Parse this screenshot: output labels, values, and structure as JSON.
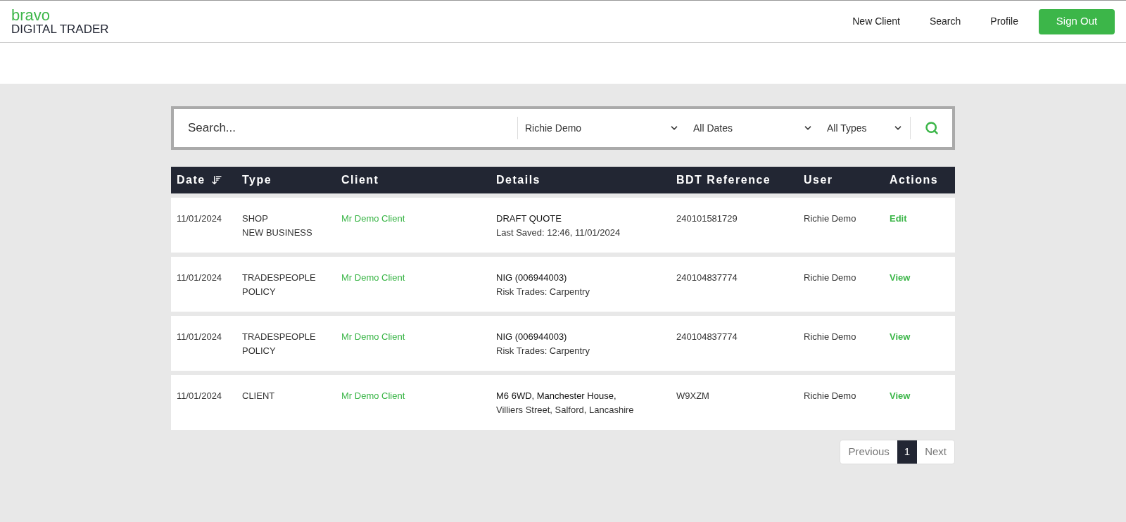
{
  "brand": {
    "logo_top": "bravo",
    "logo_bottom": "DIGITAL TRADER"
  },
  "nav": {
    "links": [
      "New Client",
      "Search",
      "Profile"
    ],
    "sign_out": "Sign Out"
  },
  "search": {
    "placeholder": "Search...",
    "filters": [
      "Richie Demo",
      "All Dates",
      "All Types"
    ]
  },
  "table": {
    "columns": [
      {
        "label": "Date",
        "sortable": true
      },
      {
        "label": "Type",
        "sortable": false
      },
      {
        "label": "Client",
        "sortable": false
      },
      {
        "label": "Details",
        "sortable": false
      },
      {
        "label": "BDT Reference",
        "sortable": false
      },
      {
        "label": "User",
        "sortable": false
      },
      {
        "label": "Actions",
        "sortable": false
      }
    ],
    "rows": [
      {
        "date": "11/01/2024",
        "type": [
          "SHOP",
          "NEW BUSINESS"
        ],
        "client": "Mr Demo Client",
        "details": [
          "DRAFT QUOTE",
          "Last Saved: 12:46, 11/01/2024"
        ],
        "reference": "240101581729",
        "user": "Richie Demo",
        "action": "Edit"
      },
      {
        "date": "11/01/2024",
        "type": [
          "TRADESPEOPLE",
          "POLICY"
        ],
        "client": "Mr Demo Client",
        "details": [
          "NIG (006944003)",
          "Risk Trades: Carpentry"
        ],
        "reference": "240104837774",
        "user": "Richie Demo",
        "action": "View"
      },
      {
        "date": "11/01/2024",
        "type": [
          "TRADESPEOPLE",
          "POLICY"
        ],
        "client": "Mr Demo Client",
        "details": [
          "NIG (006944003)",
          "Risk Trades: Carpentry"
        ],
        "reference": "240104837774",
        "user": "Richie Demo",
        "action": "View"
      },
      {
        "date": "11/01/2024",
        "type": [
          "CLIENT"
        ],
        "client": "Mr Demo Client",
        "details": [
          "M6 6WD, Manchester House,",
          "Villiers Street, Salford, Lancashire"
        ],
        "reference": "W9XZM",
        "user": "Richie Demo",
        "action": "View"
      }
    ]
  },
  "pagination": {
    "previous": "Previous",
    "pages": [
      {
        "label": "1",
        "selected": true
      }
    ],
    "next": "Next"
  }
}
